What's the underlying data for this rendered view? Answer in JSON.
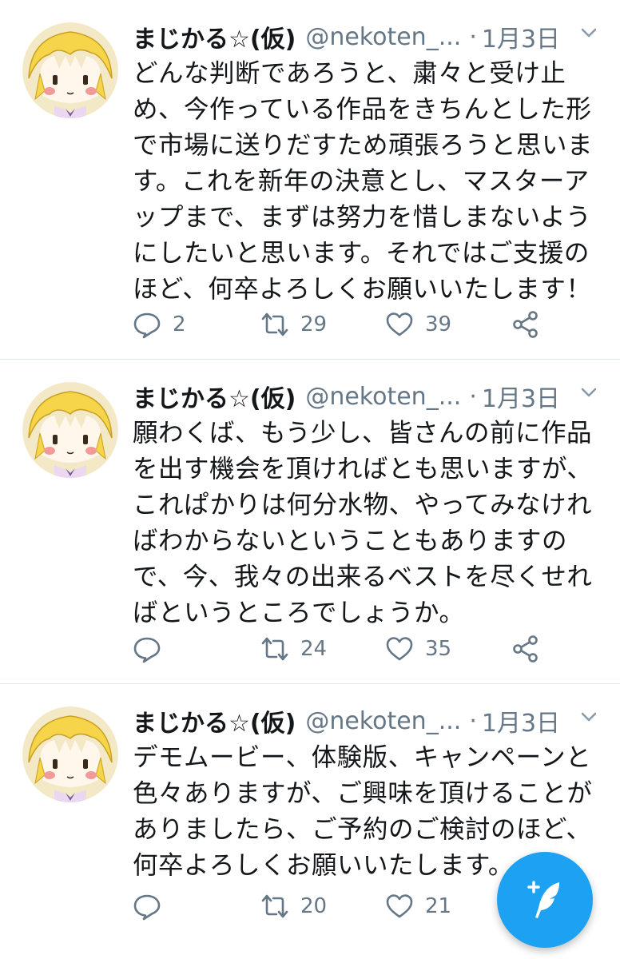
{
  "tweets": [
    {
      "author_name": "まじかる☆(仮)",
      "handle": "@nekoten_...",
      "separator": "·",
      "time": "1月3日",
      "lines": [
        "どんな判断であろうと、粛々と受け止",
        "め、今作っている作品をきちんとした形",
        "で市場に送りだすため頑張ろうと思いま",
        "す。これを新年の決意とし、マスターア",
        "ップまで、まずは努力を惜しまないよう",
        "にしたいと思います。それではご支援の",
        "ほど、何卒よろしくお願いいたします！"
      ],
      "replies": "2",
      "retweets": "29",
      "likes": "39"
    },
    {
      "author_name": "まじかる☆(仮)",
      "handle": "@nekoten_...",
      "separator": "·",
      "time": "1月3日",
      "lines": [
        "願わくば、もう少し、皆さんの前に作品",
        "を出す機会を頂ければとも思いますが、",
        "これぱかりは何分水物、やってみなけれ",
        "ばわからないということもありますの",
        "で、今、我々の出来るベストを尽くせれ",
        "ばというところでしょうか。"
      ],
      "replies": "",
      "retweets": "24",
      "likes": "35"
    },
    {
      "author_name": "まじかる☆(仮)",
      "handle": "@nekoten_...",
      "separator": "·",
      "time": "1月3日",
      "lines": [
        "デモムービー、体験版、キャンペーンと",
        "色々ありますが、ご興味を頂けることが",
        "ありましたら、ご予約のご検討のほど、",
        "何卒よろしくお願いいたします。"
      ],
      "replies": "",
      "retweets": "20",
      "likes": "21"
    }
  ],
  "icons": {
    "reply": "reply-icon",
    "retweet": "retweet-icon",
    "like": "heart-icon",
    "share": "share-icon",
    "caret": "chevron-down-icon",
    "compose": "compose-tweet-icon"
  },
  "colors": {
    "accent": "#1da1f2",
    "secondary_text": "#657786",
    "divider": "#e1e8ed"
  }
}
